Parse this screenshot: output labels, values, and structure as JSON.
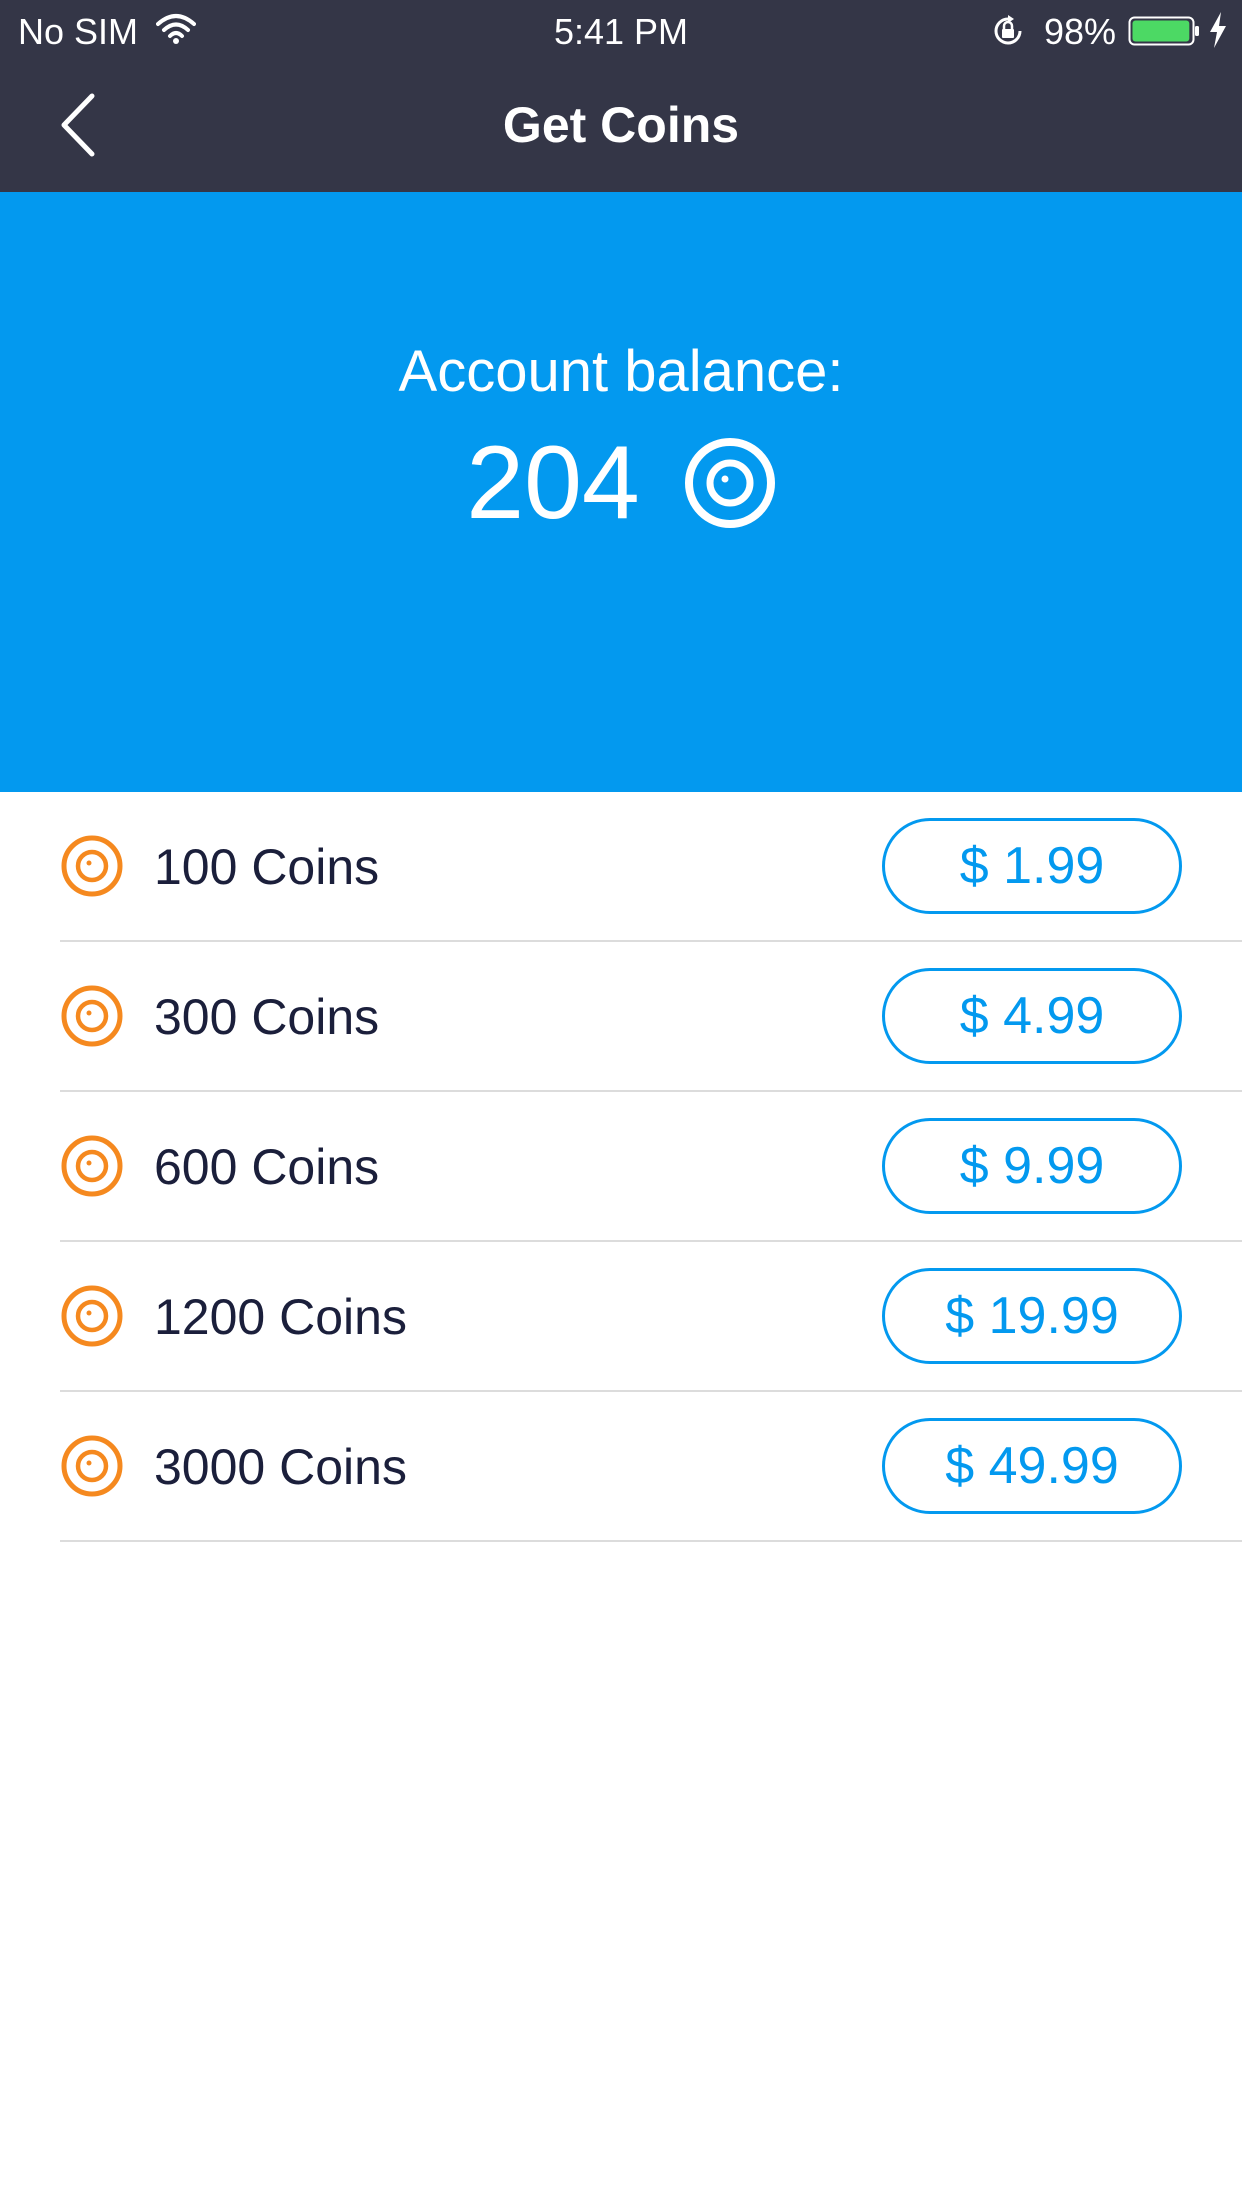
{
  "status_bar": {
    "carrier": "No SIM",
    "time": "5:41 PM",
    "battery_percent": "98%",
    "battery_level": 0.98,
    "battery_color": "#4cd964"
  },
  "nav": {
    "title": "Get Coins",
    "back_icon": "chevron-left-icon"
  },
  "balance": {
    "label": "Account balance:",
    "amount": "204",
    "icon": "coin-icon"
  },
  "packages": [
    {
      "name": "100 Coins",
      "price": "$ 1.99"
    },
    {
      "name": "300 Coins",
      "price": "$ 4.99"
    },
    {
      "name": "600 Coins",
      "price": "$ 9.99"
    },
    {
      "name": "1200 Coins",
      "price": "$ 19.99"
    },
    {
      "name": "3000 Coins",
      "price": "$ 49.99"
    }
  ],
  "colors": {
    "nav_background": "#343647",
    "hero_background": "#0399ef",
    "accent": "#0399ef",
    "coin_orange": "#f5891f",
    "text_dark": "#1b1f3b",
    "divider": "#dcdcdc"
  }
}
